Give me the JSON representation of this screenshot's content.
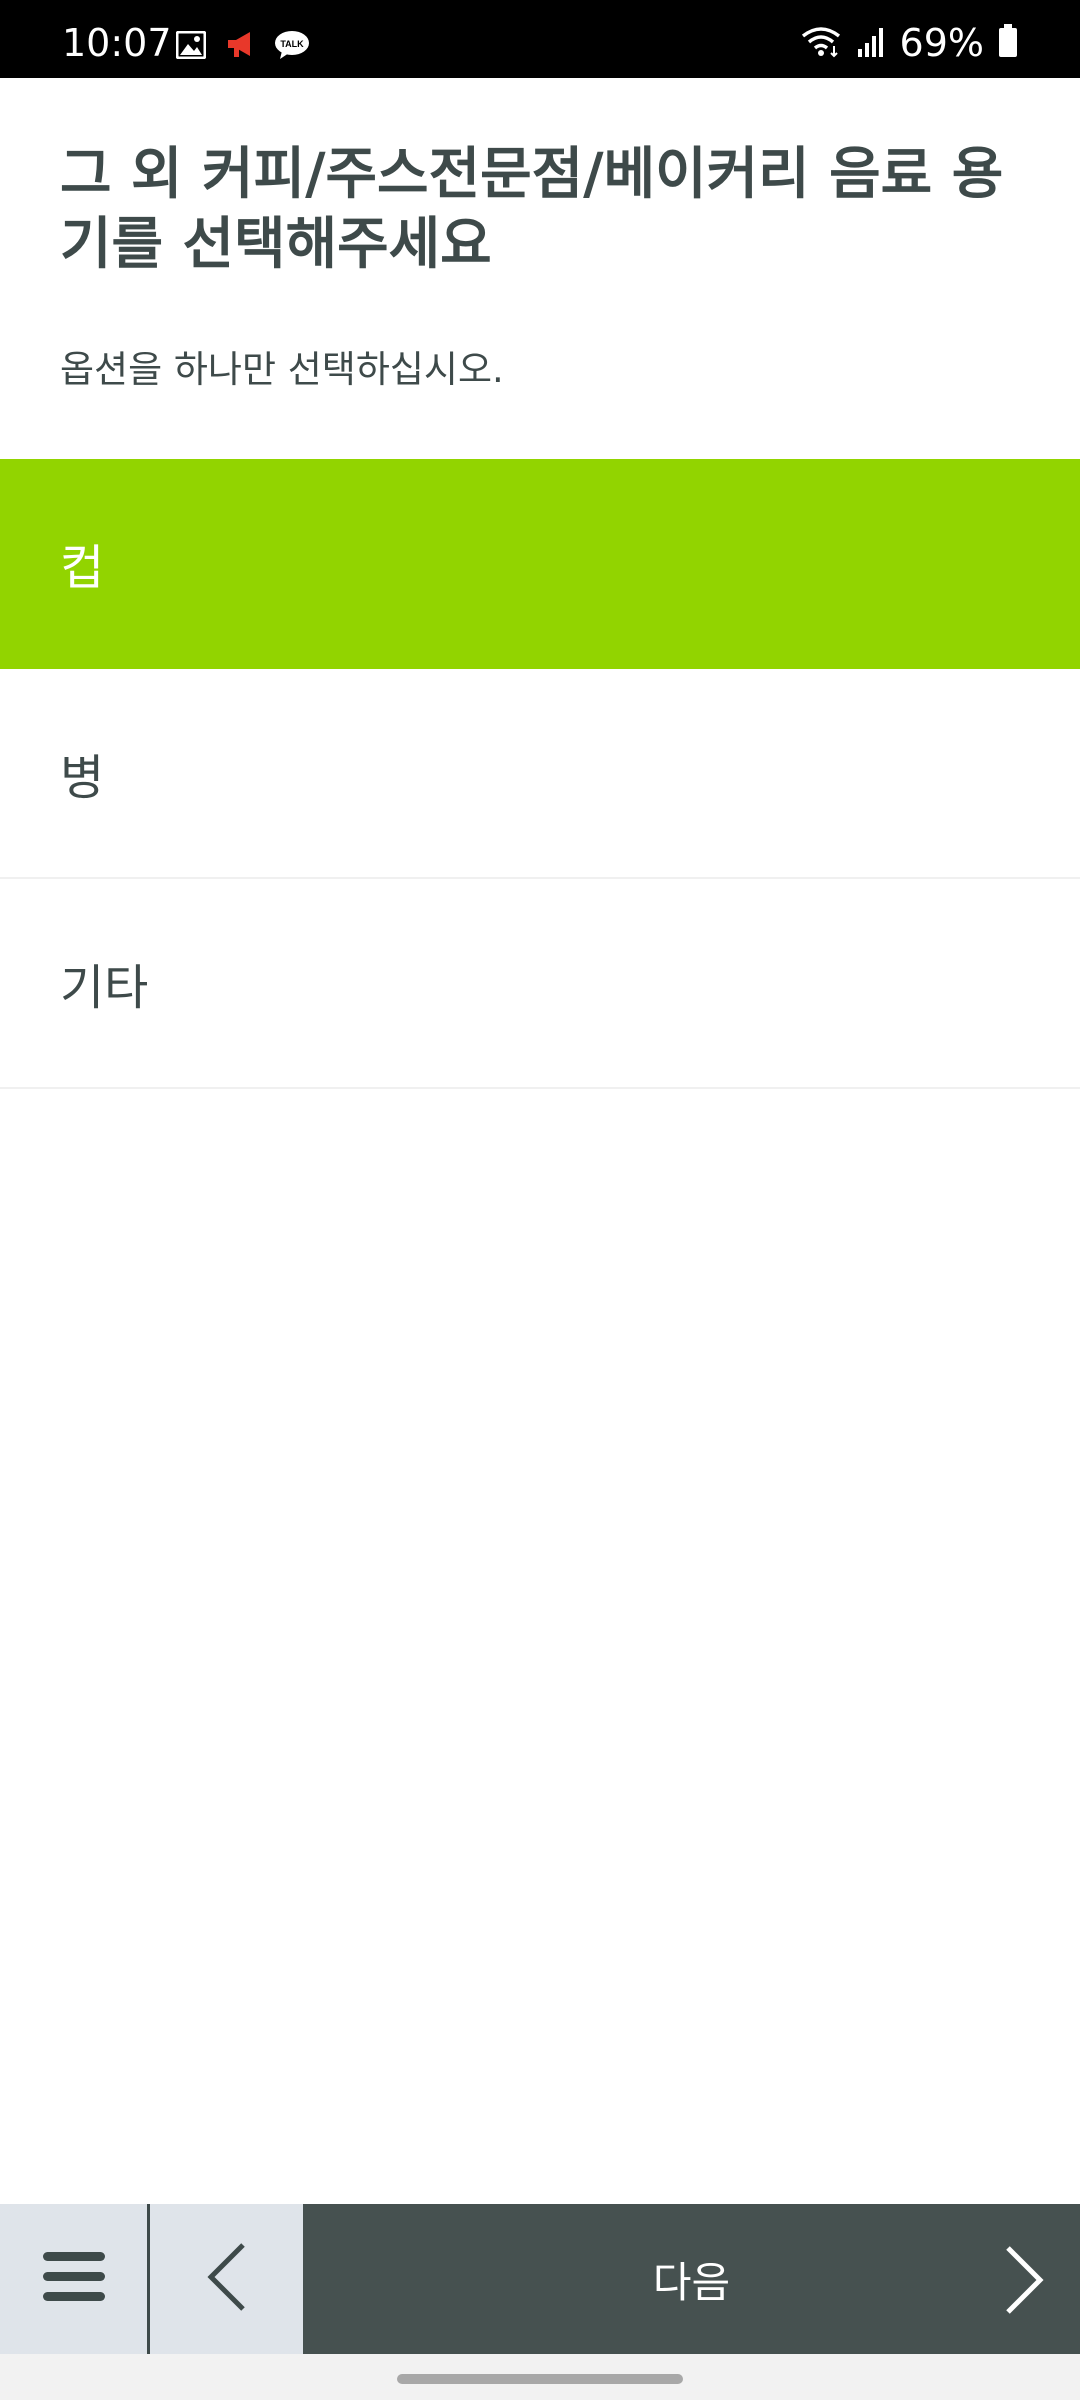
{
  "status_bar": {
    "time": "10:07",
    "battery": "69%",
    "icons": [
      "gallery-icon",
      "megaphone-icon",
      "talk-icon",
      "wifi-icon",
      "signal-icon",
      "battery-icon"
    ]
  },
  "question": {
    "title": "그 외 커피/주스전문점/베이커리 음료 용기를 선택해주세요",
    "instruction": "옵션을 하나만 선택하십시오."
  },
  "options": [
    {
      "label": "컵",
      "selected": true
    },
    {
      "label": "병",
      "selected": false
    },
    {
      "label": "기타",
      "selected": false
    }
  ],
  "bottom_bar": {
    "menu_icon": "hamburger-menu-icon",
    "back_icon": "chevron-left-icon",
    "next_label": "다음",
    "next_icon": "chevron-right-icon"
  },
  "colors": {
    "accent": "#92d400",
    "text": "#3e4a4a",
    "bottom_dark": "#465150",
    "bottom_light": "#dfe4ea"
  }
}
